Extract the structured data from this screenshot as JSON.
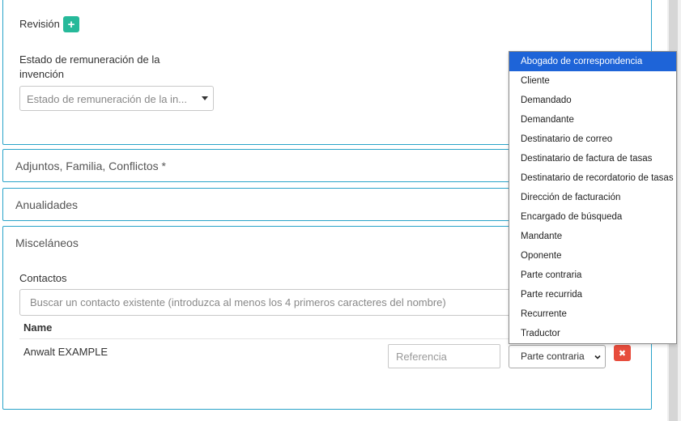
{
  "revision": {
    "label": "Revisión",
    "add_symbol": "+"
  },
  "remuneration": {
    "label": "Estado de remuneración de la invención",
    "select_text": "Estado de remuneración de la in..."
  },
  "panels": {
    "attachments": "Adjuntos, Familia, Conflictos *",
    "annuities": "Anualidades",
    "misc": "Misceláneos"
  },
  "contacts": {
    "label": "Contactos",
    "search_placeholder": "Buscar un contacto existente (introduzca al menos los 4 primeros caracteres del nombre)",
    "name_header": "Name",
    "rows": [
      {
        "name": "Anwalt EXAMPLE",
        "reference_placeholder": "Referencia",
        "role": "Parte contraria"
      }
    ]
  },
  "role_dropdown": {
    "selected_index": 0,
    "options": [
      "Abogado de correspondencia",
      "Cliente",
      "Demandado",
      "Demandante",
      "Destinatario de correo",
      "Destinatario de factura de tasas",
      "Destinatario de recordatorio de tasas",
      "Dirección de facturación",
      "Encargado de búsqueda",
      "Mandante",
      "Oponente",
      "Parte contraria",
      "Parte recurrida",
      "Recurrente",
      "Traductor"
    ]
  },
  "colors": {
    "panel_border": "#29a3c9",
    "add_button": "#26b99a",
    "delete_button": "#e74c3c",
    "dropdown_highlight": "#1e64d8"
  },
  "icons": {
    "add": "plus-icon",
    "delete": "close-icon",
    "select": "chevron-down-icon"
  }
}
